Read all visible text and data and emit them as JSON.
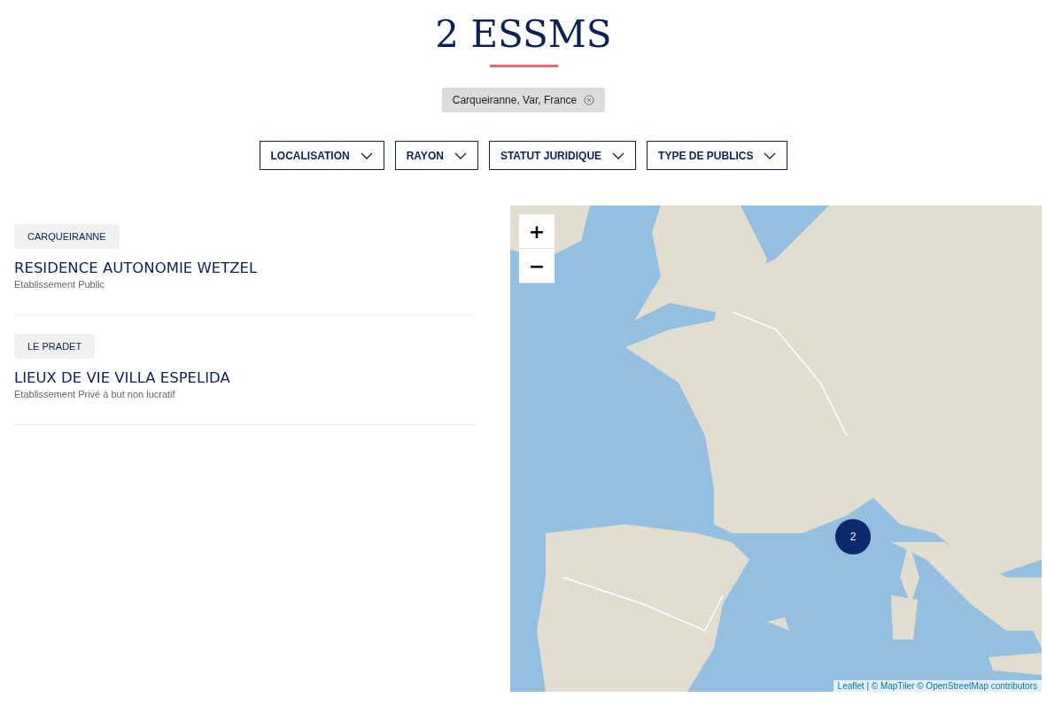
{
  "title": "2 ESSMS",
  "active_filter": {
    "label": "Carqueiranne, Var, France"
  },
  "filters": [
    {
      "label": "LOCALISATION"
    },
    {
      "label": "RAYON"
    },
    {
      "label": "STATUT JURIDIQUE"
    },
    {
      "label": "TYPE DE PUBLICS"
    }
  ],
  "results": [
    {
      "city": "CARQUEIRANNE",
      "name": "RESIDENCE AUTONOMIE WETZEL",
      "status": "Etablissement Public"
    },
    {
      "city": "LE PRADET",
      "name": "LIEUX DE VIE VILLA ESPELIDA",
      "status": "Etablissement Privé à but non lucratif"
    }
  ],
  "map": {
    "kind": "picture",
    "zoom_controls": [
      "+",
      "−"
    ],
    "cluster": {
      "count": "2"
    },
    "attribution": "Leaflet | © MapTiler © OpenStreetMap contributors"
  }
}
